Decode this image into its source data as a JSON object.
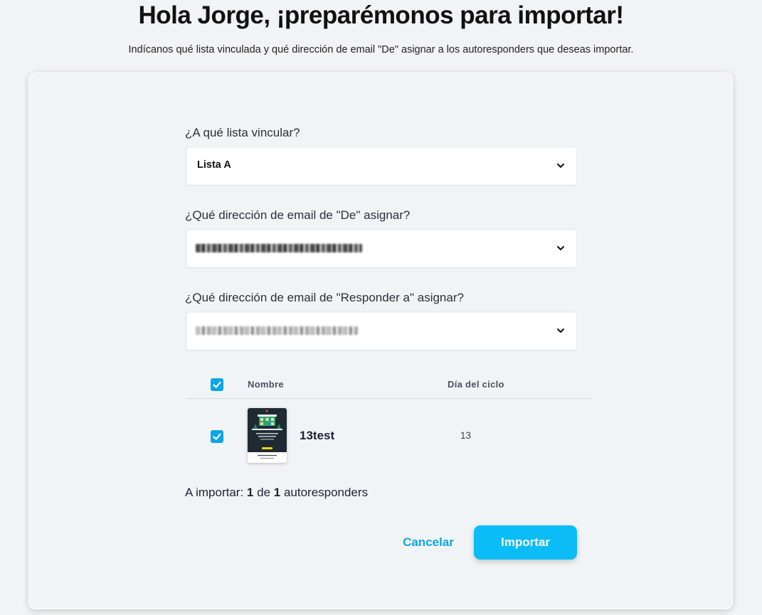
{
  "page": {
    "title": "Hola Jorge, ¡preparémonos para importar!",
    "subtitle": "Indícanos qué lista vinculada y qué dirección de email \"De\" asignar a los autoresponders que deseas importar."
  },
  "form": {
    "list_label": "¿A qué lista vincular?",
    "list_value": "Lista A",
    "from_label": "¿Qué dirección de email de \"De\" asignar?",
    "reply_label": "¿Qué dirección de email de \"Responder a\" asignar?"
  },
  "table": {
    "headers": {
      "name": "Nombre",
      "day": "Día del ciclo"
    },
    "rows": [
      {
        "name": "13test",
        "day": "13",
        "checked": true
      }
    ]
  },
  "summary": {
    "prefix": "A importar: ",
    "selected": "1",
    "of": " de ",
    "total": "1",
    "suffix": " autoresponders"
  },
  "actions": {
    "cancel": "Cancelar",
    "import": "Importar"
  },
  "colors": {
    "accent": "#0aa6e6",
    "button": "#0bbcf7",
    "background": "#f1f4f7"
  },
  "icons": {
    "dropdown": "chevron-down-icon",
    "check": "check-icon"
  }
}
